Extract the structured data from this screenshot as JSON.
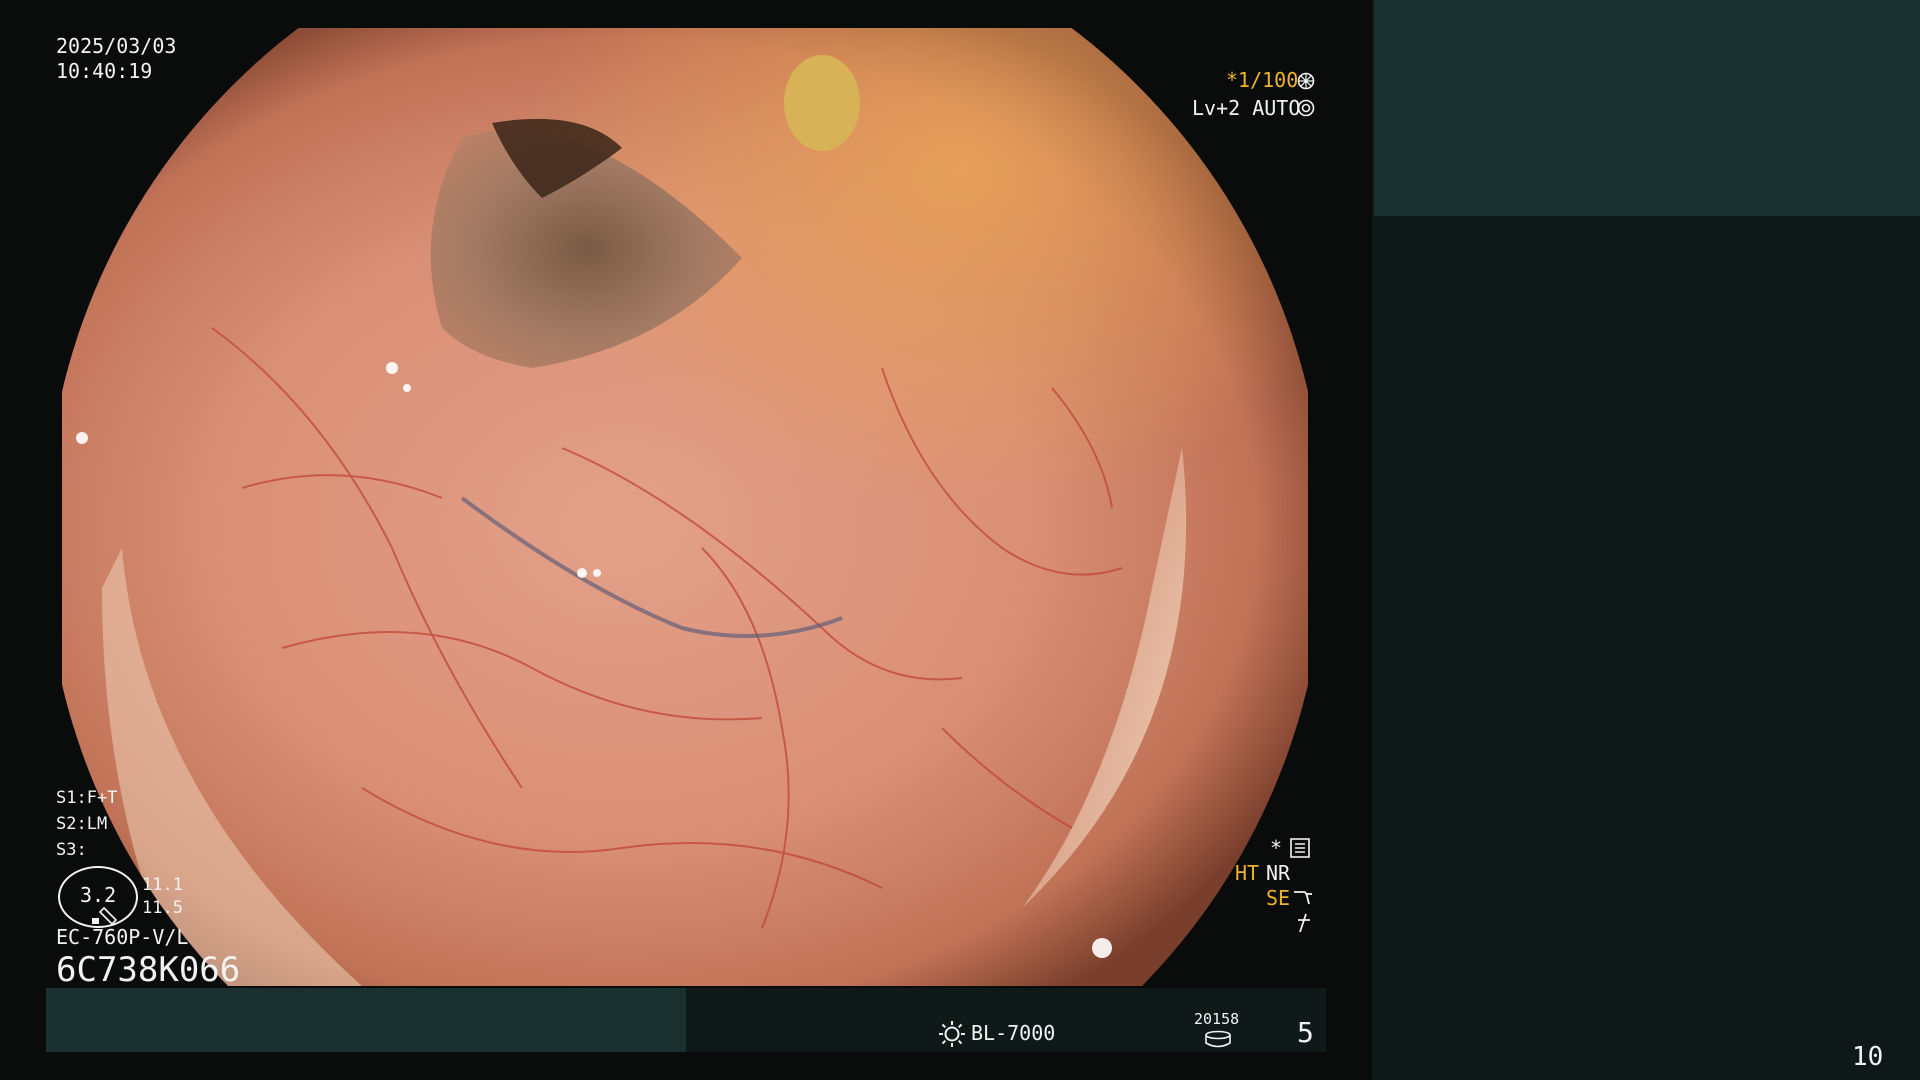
{
  "header": {
    "date": "2025/03/03",
    "time": "10:40:19"
  },
  "settings": {
    "shutter": "*1/100",
    "level_mode": "Lv+2 AUTO"
  },
  "switches": {
    "s1": "S1:F+T",
    "s2": "S2:LM",
    "s3": "S3:"
  },
  "zoom": {
    "value": "3.2",
    "val_a": "11.1",
    "val_b": "11.5"
  },
  "scope": {
    "model": "EC-760P-V/L",
    "serial": "6C738K066"
  },
  "processing": {
    "ht": "HT",
    "nr": "NR",
    "se": "SE",
    "asterisk": "*"
  },
  "footer": {
    "light_source": "BL-7000",
    "storage_count": "20158",
    "number": "5"
  },
  "page_number": "10",
  "icons": [
    "aperture-icon",
    "iris-icon",
    "menu-list-icon",
    "curve-icon",
    "sun-icon",
    "storage-icon",
    "zoom-indicator-icon",
    "function-icon"
  ],
  "colors": {
    "accent_yellow": "#f0b429",
    "panel_dark_teal": "#0f1a18",
    "panel_teal": "#1a302e"
  }
}
